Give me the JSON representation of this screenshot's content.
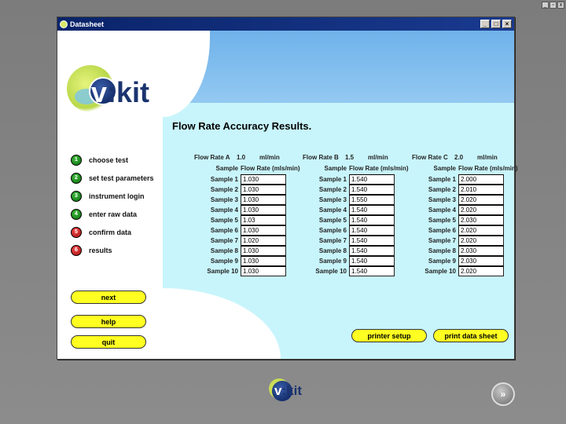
{
  "window": {
    "title": "Datasheet",
    "controls": [
      "_",
      "□",
      "×"
    ]
  },
  "logo": {
    "prefix": "v",
    "suffix": "kit"
  },
  "page_title": "Flow Rate Accuracy Results.",
  "steps": [
    {
      "num": "1",
      "label": "choose test",
      "status": "green"
    },
    {
      "num": "2",
      "label": "set test parameters",
      "status": "green"
    },
    {
      "num": "3",
      "label": "instrument login",
      "status": "green"
    },
    {
      "num": "4",
      "label": "enter raw data",
      "status": "green"
    },
    {
      "num": "5",
      "label": "confirm data",
      "status": "red"
    },
    {
      "num": "6",
      "label": "results",
      "status": "red"
    }
  ],
  "buttons": {
    "next": "next",
    "help": "help",
    "quit": "quit",
    "printer_setup": "printer setup",
    "print_data_sheet": "print data sheet"
  },
  "groups": [
    {
      "rate_label": "Flow Rate A",
      "rate_value": "1.0",
      "unit": "ml/min",
      "sample_header": "Sample",
      "value_header": "Flow Rate (mls/min)",
      "samples": [
        {
          "label": "Sample 1",
          "value": "1.030"
        },
        {
          "label": "Sample 2",
          "value": "1.030"
        },
        {
          "label": "Sample 3",
          "value": "1.030"
        },
        {
          "label": "Sample 4",
          "value": "1.030"
        },
        {
          "label": "Sample 5",
          "value": "1.03"
        },
        {
          "label": "Sample 6",
          "value": "1.030"
        },
        {
          "label": "Sample 7",
          "value": "1.020"
        },
        {
          "label": "Sample 8",
          "value": "1.030"
        },
        {
          "label": "Sample 9",
          "value": "1.030"
        },
        {
          "label": "Sample 10",
          "value": "1.030"
        }
      ]
    },
    {
      "rate_label": "Flow Rate B",
      "rate_value": "1.5",
      "unit": "ml/min",
      "sample_header": "Sample",
      "value_header": "Flow Rate (mls/min)",
      "samples": [
        {
          "label": "Sample 1",
          "value": "1.540"
        },
        {
          "label": "Sample 2",
          "value": "1.540"
        },
        {
          "label": "Sample 3",
          "value": "1.550"
        },
        {
          "label": "Sample 4",
          "value": "1.540"
        },
        {
          "label": "Sample 5",
          "value": "1.540"
        },
        {
          "label": "Sample 6",
          "value": "1.540"
        },
        {
          "label": "Sample 7",
          "value": "1.540"
        },
        {
          "label": "Sample 8",
          "value": "1.540"
        },
        {
          "label": "Sample 9",
          "value": "1.540"
        },
        {
          "label": "Sample 10",
          "value": "1.540"
        }
      ]
    },
    {
      "rate_label": "Flow Rate C",
      "rate_value": "2.0",
      "unit": "ml/min",
      "sample_header": "Sample",
      "value_header": "Flow Rate (mls/min)",
      "samples": [
        {
          "label": "Sample 1",
          "value": "2.000"
        },
        {
          "label": "Sample 2",
          "value": "2.010"
        },
        {
          "label": "Sample 3",
          "value": "2.020"
        },
        {
          "label": "Sample 4",
          "value": "2.020"
        },
        {
          "label": "Sample 5",
          "value": "2.030"
        },
        {
          "label": "Sample 6",
          "value": "2.020"
        },
        {
          "label": "Sample 7",
          "value": "2.020"
        },
        {
          "label": "Sample 8",
          "value": "2.030"
        },
        {
          "label": "Sample 9",
          "value": "2.030"
        },
        {
          "label": "Sample 10",
          "value": "2.020"
        }
      ]
    }
  ],
  "footer_logo": {
    "prefix": "v",
    "suffix": "kit"
  },
  "forward_icon": "double-chevron-right-icon",
  "colors": {
    "accent_yellow": "#ffff22",
    "panel_cyan": "#c8f5fb",
    "band_blue": "#6fb2ea",
    "step_green": "#1a8f1a",
    "step_red": "#c41a1a"
  }
}
